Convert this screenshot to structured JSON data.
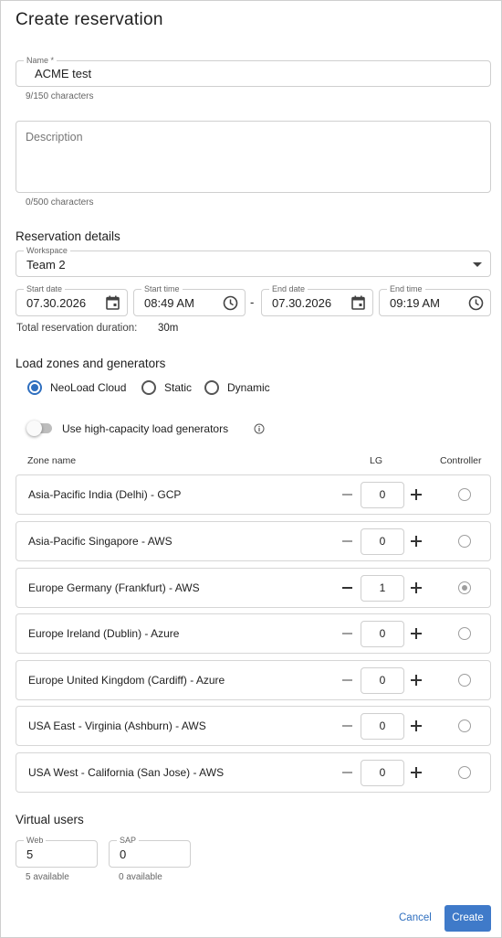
{
  "dialog": {
    "title": "Create reservation"
  },
  "name": {
    "label": "Name *",
    "value": "ACME test",
    "helper": "9/150 characters"
  },
  "description": {
    "placeholder": "Description",
    "helper": "0/500 characters"
  },
  "reservation": {
    "heading": "Reservation details",
    "workspace": {
      "label": "Workspace",
      "value": "Team 2"
    },
    "start_date": {
      "label": "Start date",
      "value": "07.30.2026"
    },
    "start_time": {
      "label": "Start time",
      "value": "08:49 AM"
    },
    "separator": "-",
    "end_date": {
      "label": "End date",
      "value": "07.30.2026"
    },
    "end_time": {
      "label": "End time",
      "value": "09:19 AM"
    },
    "duration_label": "Total reservation duration:",
    "duration_value": "30m"
  },
  "load": {
    "heading": "Load zones and generators",
    "options": [
      {
        "label": "NeoLoad Cloud",
        "selected": true
      },
      {
        "label": "Static",
        "selected": false
      },
      {
        "label": "Dynamic",
        "selected": false
      }
    ],
    "high_capacity_label": "Use high-capacity load generators",
    "high_capacity_enabled": false,
    "columns": {
      "zone": "Zone name",
      "lg": "LG",
      "controller": "Controller"
    },
    "zones": [
      {
        "name": "Asia-Pacific India (Delhi) - GCP",
        "lg": "0",
        "controller": false
      },
      {
        "name": "Asia-Pacific Singapore - AWS",
        "lg": "0",
        "controller": false
      },
      {
        "name": "Europe Germany (Frankfurt) - AWS",
        "lg": "1",
        "controller": true
      },
      {
        "name": "Europe Ireland (Dublin) - Azure",
        "lg": "0",
        "controller": false
      },
      {
        "name": "Europe United Kingdom (Cardiff) - Azure",
        "lg": "0",
        "controller": false
      },
      {
        "name": "USA East - Virginia (Ashburn) - AWS",
        "lg": "0",
        "controller": false
      },
      {
        "name": "USA West - California (San Jose) - AWS",
        "lg": "0",
        "controller": false
      }
    ]
  },
  "virtual_users": {
    "heading": "Virtual users",
    "web": {
      "label": "Web",
      "value": "5",
      "helper": "5 available"
    },
    "sap": {
      "label": "SAP",
      "value": "0",
      "helper": "0 available"
    }
  },
  "actions": {
    "cancel": "Cancel",
    "create": "Create"
  },
  "colors": {
    "accent": "#3f7ac9",
    "link": "#2f6fbf",
    "border": "#cfcfcf"
  },
  "icons": {
    "calendar": "calendar-icon",
    "clock": "clock-icon",
    "dropdown": "caret-down-icon",
    "info": "info-icon"
  }
}
